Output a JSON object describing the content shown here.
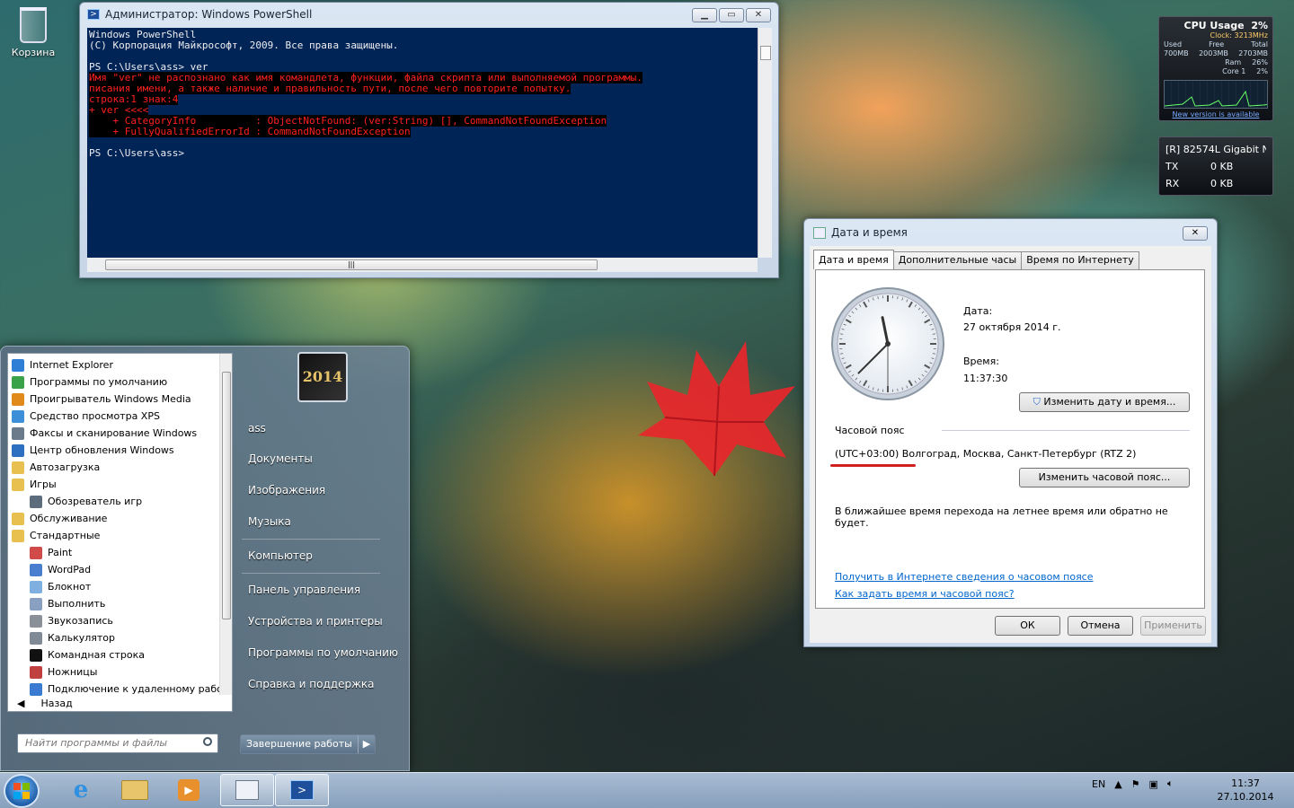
{
  "desktop": {
    "recycle_bin": "Корзина"
  },
  "gadgets": {
    "cpu": {
      "title": "CPU Usage",
      "value": "2%",
      "clock": "Clock: 3213MHz",
      "used_label": "Used",
      "free_label": "Free",
      "total_label": "Total",
      "used": "700MB",
      "free": "2003MB",
      "total": "2703MB",
      "ram_label": "Ram",
      "ram": "26%",
      "core_label": "Core 1",
      "core": "2%",
      "link": "New version is available"
    },
    "net": {
      "adapter": "[R] 82574L Gigabit N",
      "tx_label": "TX",
      "tx": "0 KB",
      "rx_label": "RX",
      "rx": "0 KB"
    }
  },
  "powershell": {
    "title": "Администратор: Windows PowerShell",
    "lines": [
      {
        "t": "Windows PowerShell",
        "err": false
      },
      {
        "t": "(C) Корпорация Майкрософт, 2009. Все права защищены.",
        "err": false
      },
      {
        "t": "",
        "err": false
      },
      {
        "t": "PS C:\\Users\\ass> ver",
        "err": false
      },
      {
        "t": "Имя \"ver\" не распознано как имя командлета, функции, файла скрипта или выполняемой программы.",
        "err": true
      },
      {
        "t": "писания имени, а также наличие и правильность пути, после чего повторите попытку.",
        "err": true
      },
      {
        "t": "строка:1 знак:4",
        "err": true
      },
      {
        "t": "+ ver <<<<",
        "err": true
      },
      {
        "t": "    + CategoryInfo          : ObjectNotFound: (ver:String) [], CommandNotFoundException",
        "err": true
      },
      {
        "t": "    + FullyQualifiedErrorId : CommandNotFoundException",
        "err": true
      },
      {
        "t": "",
        "err": false
      },
      {
        "t": "PS C:\\Users\\ass>",
        "err": false
      }
    ]
  },
  "datetime": {
    "title": "Дата и время",
    "close": "✕",
    "tabs": [
      "Дата и время",
      "Дополнительные часы",
      "Время по Интернету"
    ],
    "clock_value": {
      "hours": 11,
      "minutes": 37,
      "seconds": 30
    },
    "date_label": "Дата:",
    "date_value": "27 октября 2014 г.",
    "time_label": "Время:",
    "time_value": "11:37:30",
    "change_datetime_btn": "Изменить дату и время...",
    "timezone_label": "Часовой пояс",
    "timezone_value": "(UTC+03:00) Волгоград, Москва, Санкт-Петербург (RTZ 2)",
    "change_tz_btn": "Изменить часовой пояс...",
    "dst_note": "В ближайшее время перехода на летнее время или обратно не будет.",
    "link1": "Получить в Интернете сведения о часовом поясе",
    "link2": "Как задать время и часовой пояс?",
    "ok": "ОК",
    "cancel": "Отмена",
    "apply": "Применить",
    "accent_underline": "#d02020"
  },
  "startmenu": {
    "programs": [
      {
        "label": "Internet Explorer",
        "sub": false,
        "color": "#2f7fd6"
      },
      {
        "label": "Программы по умолчанию",
        "sub": false,
        "color": "#3aa34a"
      },
      {
        "label": "Проигрыватель Windows Media",
        "sub": false,
        "color": "#e08a1c"
      },
      {
        "label": "Средство просмотра XPS",
        "sub": false,
        "color": "#3d8fd8"
      },
      {
        "label": "Факсы и сканирование Windows",
        "sub": false,
        "color": "#6b7b8c"
      },
      {
        "label": "Центр обновления Windows",
        "sub": false,
        "color": "#2d6fc0"
      },
      {
        "label": "Автозагрузка",
        "sub": false,
        "color": "#e8c050"
      },
      {
        "label": "Игры",
        "sub": false,
        "color": "#e8c050"
      },
      {
        "label": "Обозреватель игр",
        "sub": true,
        "color": "#5c6c7c"
      },
      {
        "label": "Обслуживание",
        "sub": false,
        "color": "#e8c050"
      },
      {
        "label": "Стандартные",
        "sub": false,
        "color": "#e8c050"
      },
      {
        "label": "Paint",
        "sub": true,
        "color": "#d04a4a"
      },
      {
        "label": "WordPad",
        "sub": true,
        "color": "#4a7fd0"
      },
      {
        "label": "Блокнот",
        "sub": true,
        "color": "#7fb0e0"
      },
      {
        "label": "Выполнить",
        "sub": true,
        "color": "#8aa0c0"
      },
      {
        "label": "Звукозапись",
        "sub": true,
        "color": "#8a9098"
      },
      {
        "label": "Калькулятор",
        "sub": true,
        "color": "#7f8a96"
      },
      {
        "label": "Командная строка",
        "sub": true,
        "color": "#111111"
      },
      {
        "label": "Ножницы",
        "sub": true,
        "color": "#c04040"
      },
      {
        "label": "Подключение к удаленному рабо",
        "sub": true,
        "color": "#3a7ad0"
      }
    ],
    "back": "Назад",
    "search_placeholder": "Найти программы и файлы",
    "avatar_text": "2014",
    "user": "ass",
    "right": [
      "Документы",
      "Изображения",
      "Музыка",
      "Компьютер",
      "Панель управления",
      "Устройства и принтеры",
      "Программы по умолчанию",
      "Справка и поддержка"
    ],
    "shutdown": "Завершение работы",
    "shutdown_arrow": "▶"
  },
  "taskbar": {
    "lang": "EN",
    "time": "11:37",
    "date": "27.10.2014"
  }
}
